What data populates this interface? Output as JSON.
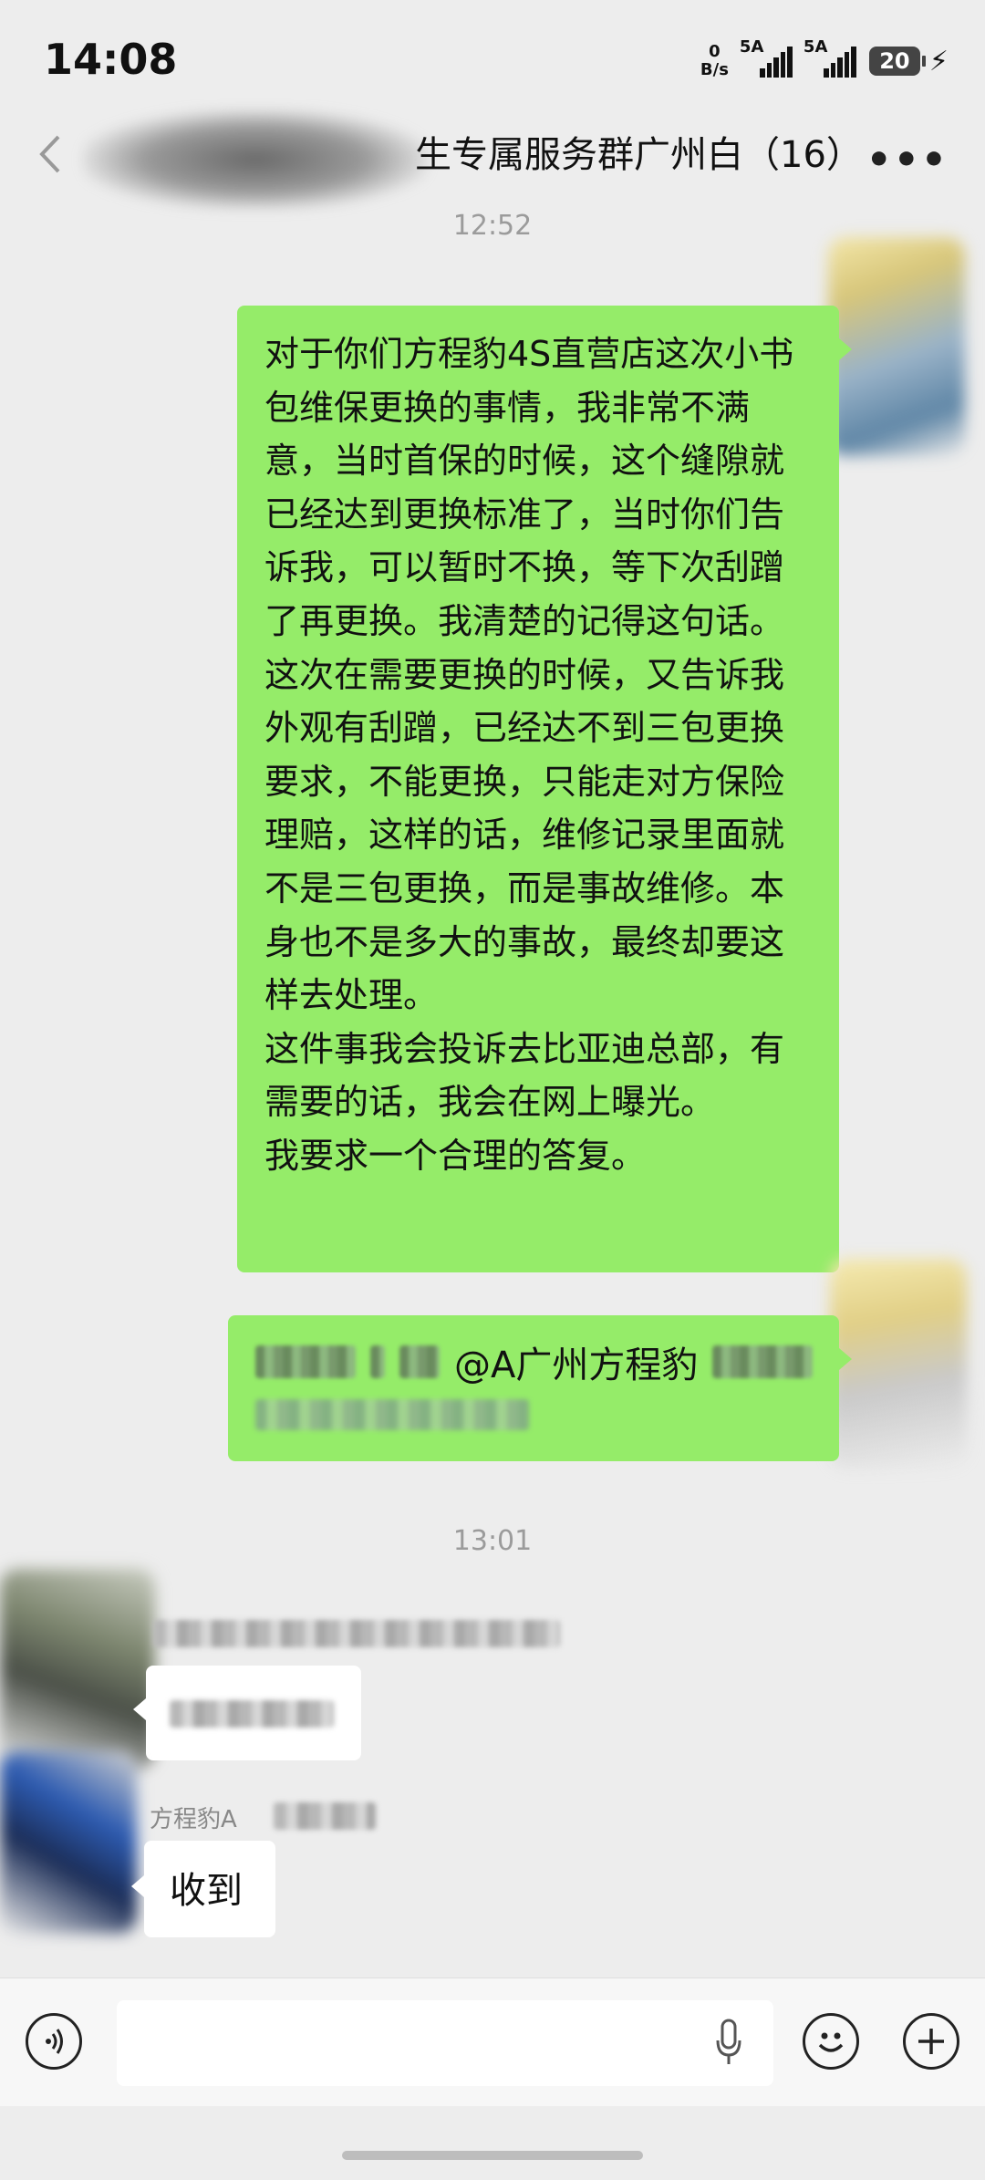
{
  "status_bar": {
    "time": "14:08",
    "net_speed_value": "0",
    "net_speed_unit": "B/s",
    "signal1_label": "5A",
    "signal2_label": "5A",
    "battery": "20",
    "charging_icon": "bolt-icon"
  },
  "header": {
    "back_icon": "chevron-left-icon",
    "title": "生专属服务群广州白（16）",
    "more_icon": "more-horizontal-icon"
  },
  "messages": {
    "time1": "12:52",
    "msg1_text": "对于你们方程豹4S直营店这次小书包维保更换的事情，我非常不满意，当时首保的时候，这个缝隙就已经达到更换标准了，当时你们告诉我，可以暂时不换，等下次刮蹭了再更换。我清楚的记得这句话。\n这次在需要更换的时候，又告诉我外观有刮蹭，已经达不到三包更换要求，不能更换，只能走对方保险理赔，这样的话，维修记录里面就不是三包更换，而是事故维修。本身也不是多大的事故，最终却要这样去处理。\n这件事我会投诉去比亚迪总部，有需要的话，我会在网上曝光。\n我要求一个合理的答复。",
    "msg2_mention": "@A广州方程豹",
    "time2": "13:01",
    "sender2_name": "方程豹A",
    "reply_text": "收到"
  },
  "input_bar": {
    "voice_icon": "voice-icon",
    "mic_icon": "microphone-icon",
    "emoji_icon": "emoji-icon",
    "plus_icon": "plus-icon"
  },
  "colors": {
    "background": "#ededed",
    "self_bubble": "#95ec69",
    "other_bubble": "#ffffff",
    "timestamp": "#9b9b9b"
  }
}
